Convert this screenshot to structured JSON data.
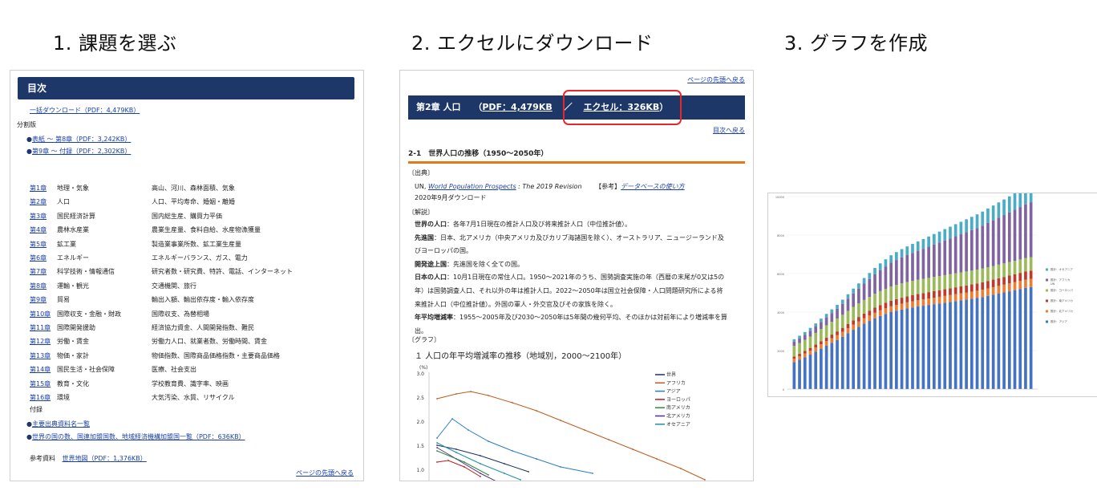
{
  "steps": [
    "1. 課題を選ぶ",
    "2. エクセルにダウンロード",
    "3. グラフを作成"
  ],
  "toc": {
    "header": "目次",
    "bulk_download": "一括ダウンロード（PDF：4,479KB）",
    "split_label": "分割版",
    "split_items": [
      "表紙 ～ 第8章（PDF：3,242KB）",
      "第9章 ～ 付録（PDF：2,302KB）"
    ],
    "chapters": [
      {
        "no": "第1章",
        "name": "地理・気象",
        "desc": "高山、河川、森林面積、気象"
      },
      {
        "no": "第2章",
        "name": "人口",
        "desc": "人口、平均寿命、婚姻・離婚"
      },
      {
        "no": "第3章",
        "name": "国民経済計算",
        "desc": "国内総生産、購買力平価"
      },
      {
        "no": "第4章",
        "name": "農林水産業",
        "desc": "農業生産量、食料自給、水産物漁獲量"
      },
      {
        "no": "第5章",
        "name": "鉱工業",
        "desc": "製造業事業所数、鉱工業生産量"
      },
      {
        "no": "第6章",
        "name": "エネルギー",
        "desc": "エネルギーバランス、ガス、電力"
      },
      {
        "no": "第7章",
        "name": "科学技術・情報通信",
        "desc": "研究者数・研究費、特許、電話、インターネット"
      },
      {
        "no": "第8章",
        "name": "運輸・観光",
        "desc": "交通機関、旅行"
      },
      {
        "no": "第9章",
        "name": "貿易",
        "desc": "輸出入額、輸出依存度・輸入依存度"
      },
      {
        "no": "第10章",
        "name": "国際収支・金融・財政",
        "desc": "国際収支、為替相場"
      },
      {
        "no": "第11章",
        "name": "国際開発援助",
        "desc": "経済協力資金、人間開発指数、難民"
      },
      {
        "no": "第12章",
        "name": "労働・賃金",
        "desc": "労働力人口、就業者数、労働時間、賃金"
      },
      {
        "no": "第13章",
        "name": "物価・家計",
        "desc": "物価指数、国際商品価格指数・主要商品価格"
      },
      {
        "no": "第14章",
        "name": "国民生活・社会保障",
        "desc": "医療、社会支出"
      },
      {
        "no": "第15章",
        "name": "教育・文化",
        "desc": "学校教育費、識字率、映画"
      },
      {
        "no": "第16章",
        "name": "環境",
        "desc": "大気汚染、水質、リサイクル"
      }
    ],
    "appendix_label": "付録",
    "appendix_items": [
      "主要出典資料名一覧",
      "世界の国の数、国連加盟国数、地域経済機構加盟国一覧（PDF：636KB）"
    ],
    "ref_label": "参考資料",
    "ref_link": "世界地図（PDF：1,376KB）",
    "back_top": "ページの先頭へ戻る"
  },
  "detail": {
    "back_top": "ページの先頭へ戻る",
    "chapter_title": "第2章 人口",
    "pdf_link": "PDF：4,479KB",
    "excel_link": "エクセル：326KB",
    "toc_back": "目次へ戻る",
    "section_title": "2-1　世界人口の推移（1950～2050年）",
    "source_label": "〔出典〕",
    "source_prefix": "UN, ",
    "source_link": "World Population Prospects",
    "source_suffix": " : The 2019 Revision",
    "ref_label": "【参考】",
    "ref_link": "データベースの使い方",
    "downloaded": "2020年9月ダウンロード",
    "notes_label": "〔解説〕",
    "notes": [
      {
        "term": "世界の人口",
        "text": "：各年7月1日現在の推計人口及び将来推計人口（中位推計値）。"
      },
      {
        "term": "先進国",
        "text": "：日本、北アメリカ（中央アメリカ及びカリブ海諸国を除く）、オーストラリア、ニュージーランド及"
      },
      {
        "term": "",
        "text": "びヨーロッパの国。"
      },
      {
        "term": "開発途上国",
        "text": "：先進国を除く全ての国。"
      },
      {
        "term": "日本の人口",
        "text": "：10月1日現在の常住人口。1950～2021年のうち、国勢調査実施の年（西暦の末尾が0又は5の"
      },
      {
        "term": "",
        "text": "年）は国勢調査人口、それ以外の年は推計人口。2022～2050年は国立社会保障・人口問題研究所による将"
      },
      {
        "term": "",
        "text": "来推計人口（中位推計値）。外国の軍人・外交官及びその家族を除く。"
      },
      {
        "term": "年平均増減率",
        "text": "：1955～2005年及び2030～2050年は5年間の幾何平均、そのほかは対前年により増減率を算"
      },
      {
        "term": "",
        "text": "出。"
      }
    ],
    "graph_label": "〔グラフ〕",
    "graph_title": "１ 人口の年平均増減率の推移（地域別，2000～2100年）",
    "graph_unit": "(%)",
    "y_ticks": [
      "3.0",
      "2.5",
      "2.0",
      "1.5",
      "1.0"
    ],
    "legend": [
      "世界",
      "アフリカ",
      "アジア",
      "ヨーロッパ",
      "南アメリカ",
      "北アメリカ",
      "オセアニア"
    ],
    "legend_colors": [
      "#1b2f6b",
      "#c05a1a",
      "#2b7cc7",
      "#b81e1e",
      "#2e8b3d",
      "#5b2c8f",
      "#1e8fa8"
    ]
  },
  "chart_data": {
    "type": "bar",
    "stacked": true,
    "title": "",
    "y_ticks": [
      "10000",
      "8000",
      "6000",
      "4000",
      "2000",
      "0"
    ],
    "ylim": [
      0,
      10000
    ],
    "series": [
      {
        "name": "推計：アジア",
        "color": "#4472c4",
        "values": [
          1400,
          1520,
          1650,
          1790,
          1940,
          2100,
          2250,
          2400,
          2550,
          2720,
          2900,
          3080,
          3240,
          3400,
          3540,
          3680,
          3800,
          3900,
          4000,
          4070,
          4130,
          4190,
          4240,
          4290,
          4330,
          4370,
          4410,
          4450,
          4490,
          4530,
          4570,
          4610,
          4650,
          4690,
          4730,
          4780,
          4840,
          4900,
          4960,
          5020,
          5080,
          5140,
          5200,
          5260,
          5300
        ]
      },
      {
        "name": "推計：北アメリカ",
        "color": "#ed7d31",
        "values": [
          180,
          190,
          200,
          210,
          220,
          230,
          240,
          245,
          250,
          255,
          260,
          265,
          270,
          275,
          280,
          285,
          290,
          295,
          300,
          305,
          310,
          315,
          320,
          325,
          330,
          335,
          340,
          345,
          350,
          355,
          360,
          365,
          370,
          375,
          380,
          385,
          390,
          395,
          400,
          405,
          410,
          415,
          420,
          425,
          430
        ]
      },
      {
        "name": "推計：南アメリカ",
        "color": "#c0392b",
        "values": [
          110,
          120,
          130,
          140,
          150,
          160,
          175,
          185,
          195,
          205,
          215,
          225,
          235,
          245,
          255,
          265,
          275,
          285,
          295,
          300,
          305,
          310,
          315,
          320,
          325,
          330,
          335,
          340,
          345,
          350,
          355,
          360,
          365,
          370,
          375,
          380,
          385,
          390,
          395,
          400,
          405,
          410,
          415,
          420,
          425
        ]
      },
      {
        "name": "推計：ヨーロッパ",
        "color": "#9bbb59",
        "values": [
          550,
          560,
          575,
          590,
          610,
          630,
          650,
          660,
          670,
          680,
          690,
          700,
          705,
          710,
          715,
          720,
          725,
          730,
          735,
          740,
          745,
          745,
          745,
          745,
          740,
          740,
          740,
          735,
          735,
          730,
          730,
          725,
          725,
          720,
          720,
          715,
          715,
          710,
          710,
          705,
          705,
          700,
          700,
          700,
          700
        ]
      },
      {
        "name": "推計：アフリカ",
        "color": "#8064a2",
        "values": [
          230,
          250,
          270,
          300,
          330,
          370,
          410,
          460,
          510,
          570,
          630,
          700,
          770,
          850,
          930,
          1010,
          1090,
          1160,
          1230,
          1290,
          1350,
          1400,
          1450,
          1500,
          1560,
          1620,
          1680,
          1740,
          1800,
          1860,
          1920,
          1980,
          2040,
          2100,
          2160,
          2230,
          2300,
          2370,
          2440,
          2510,
          2580,
          2650,
          2720,
          2790,
          2850
        ]
      },
      {
        "name": "推計：オセアニア",
        "color": "#4bacc6",
        "values": [
          120,
          130,
          140,
          150,
          160,
          170,
          180,
          190,
          200,
          215,
          230,
          250,
          270,
          290,
          310,
          330,
          350,
          370,
          390,
          410,
          430,
          450,
          470,
          490,
          510,
          530,
          550,
          570,
          590,
          610,
          630,
          650,
          670,
          690,
          710,
          730,
          750,
          770,
          790,
          810,
          830,
          850,
          870,
          890,
          900
        ]
      }
    ],
    "legend": [
      "推計：オセアニア",
      "推計：アフリカ\nUN",
      "推計：ヨーロッパ",
      "推計：南アメリカ",
      "推計：北アメリカ",
      "推計：アジア"
    ]
  }
}
